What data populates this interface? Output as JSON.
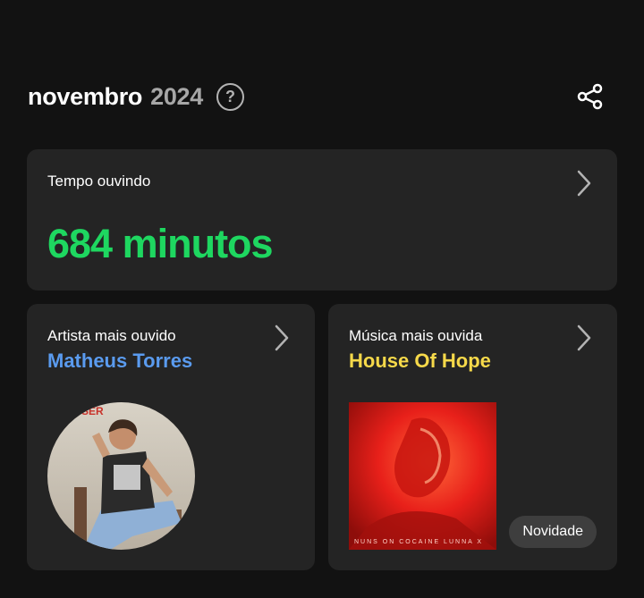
{
  "header": {
    "month": "novembro",
    "year": "2024",
    "help_glyph": "?"
  },
  "time_card": {
    "label": "Tempo ouvindo",
    "value": "684 minutos"
  },
  "artist_card": {
    "label": "Artista mais ouvido",
    "name": "Matheus Torres"
  },
  "track_card": {
    "label": "Música mais ouvida",
    "title": "House Of Hope",
    "badge": "Novidade",
    "cover_text": "NUNS ON COCAINE  LUNNA X"
  },
  "colors": {
    "background": "#121212",
    "card": "#242424",
    "minutes_green": "#1ed760",
    "artist_blue": "#5a9bef",
    "track_yellow": "#f6d94a"
  },
  "icons": [
    "help-circle-icon",
    "share-icon",
    "chevron-right-icon"
  ]
}
